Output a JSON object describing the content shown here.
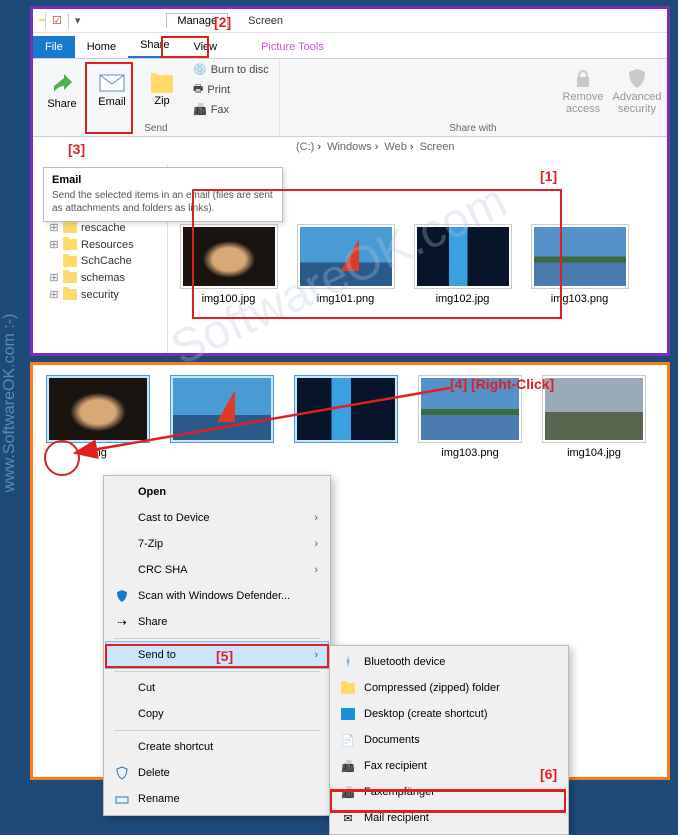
{
  "watermark_side": "www.SoftwareOK.com  :-)",
  "watermark_diag": "SoftwareOK.com",
  "window": {
    "title": "Screen",
    "manage_tab": "Manage",
    "manage_sub": "Picture Tools"
  },
  "tabs": {
    "file": "File",
    "home": "Home",
    "share": "Share",
    "view": "View"
  },
  "ribbon": {
    "share": "Share",
    "email": "Email",
    "zip": "Zip",
    "burn": "Burn to disc",
    "print": "Print",
    "fax": "Fax",
    "remove": "Remove\naccess",
    "advsec": "Advanced\nsecurity",
    "grp_send": "Send",
    "grp_share": "Share with"
  },
  "tooltip": {
    "title": "Email",
    "body": "Send the selected items in an email (files are sent as attachments and folders as links)."
  },
  "breadcrumb": {
    "a": "(C:)",
    "b": "Windows",
    "c": "Web",
    "d": "Screen"
  },
  "tree": [
    "rescache",
    "Resources",
    "SchCache",
    "schemas",
    "security"
  ],
  "files_top": [
    "img100.jpg",
    "img101.png",
    "img102.jpg",
    "img103.png"
  ],
  "files_bot": [
    "img",
    "",
    "",
    "img103.png",
    "img104.jpg"
  ],
  "ctx": {
    "open": "Open",
    "cast": "Cast to Device",
    "zip": "7-Zip",
    "crc": "CRC SHA",
    "defender": "Scan with Windows Defender...",
    "share": "Share",
    "sendto": "Send to",
    "cut": "Cut",
    "copy": "Copy",
    "shortcut": "Create shortcut",
    "delete": "Delete",
    "rename": "Rename"
  },
  "sendto": {
    "bt": "Bluetooth device",
    "zip": "Compressed (zipped) folder",
    "desk": "Desktop (create shortcut)",
    "docs": "Documents",
    "fax": "Fax recipient",
    "faxde": "Faxempfänger",
    "mail": "Mail recipient"
  },
  "anno": {
    "1": "[1]",
    "2": "[2]",
    "3": "[3]",
    "4": "[4]  [Right-Click]",
    "5": "[5]",
    "6": "[6]"
  }
}
